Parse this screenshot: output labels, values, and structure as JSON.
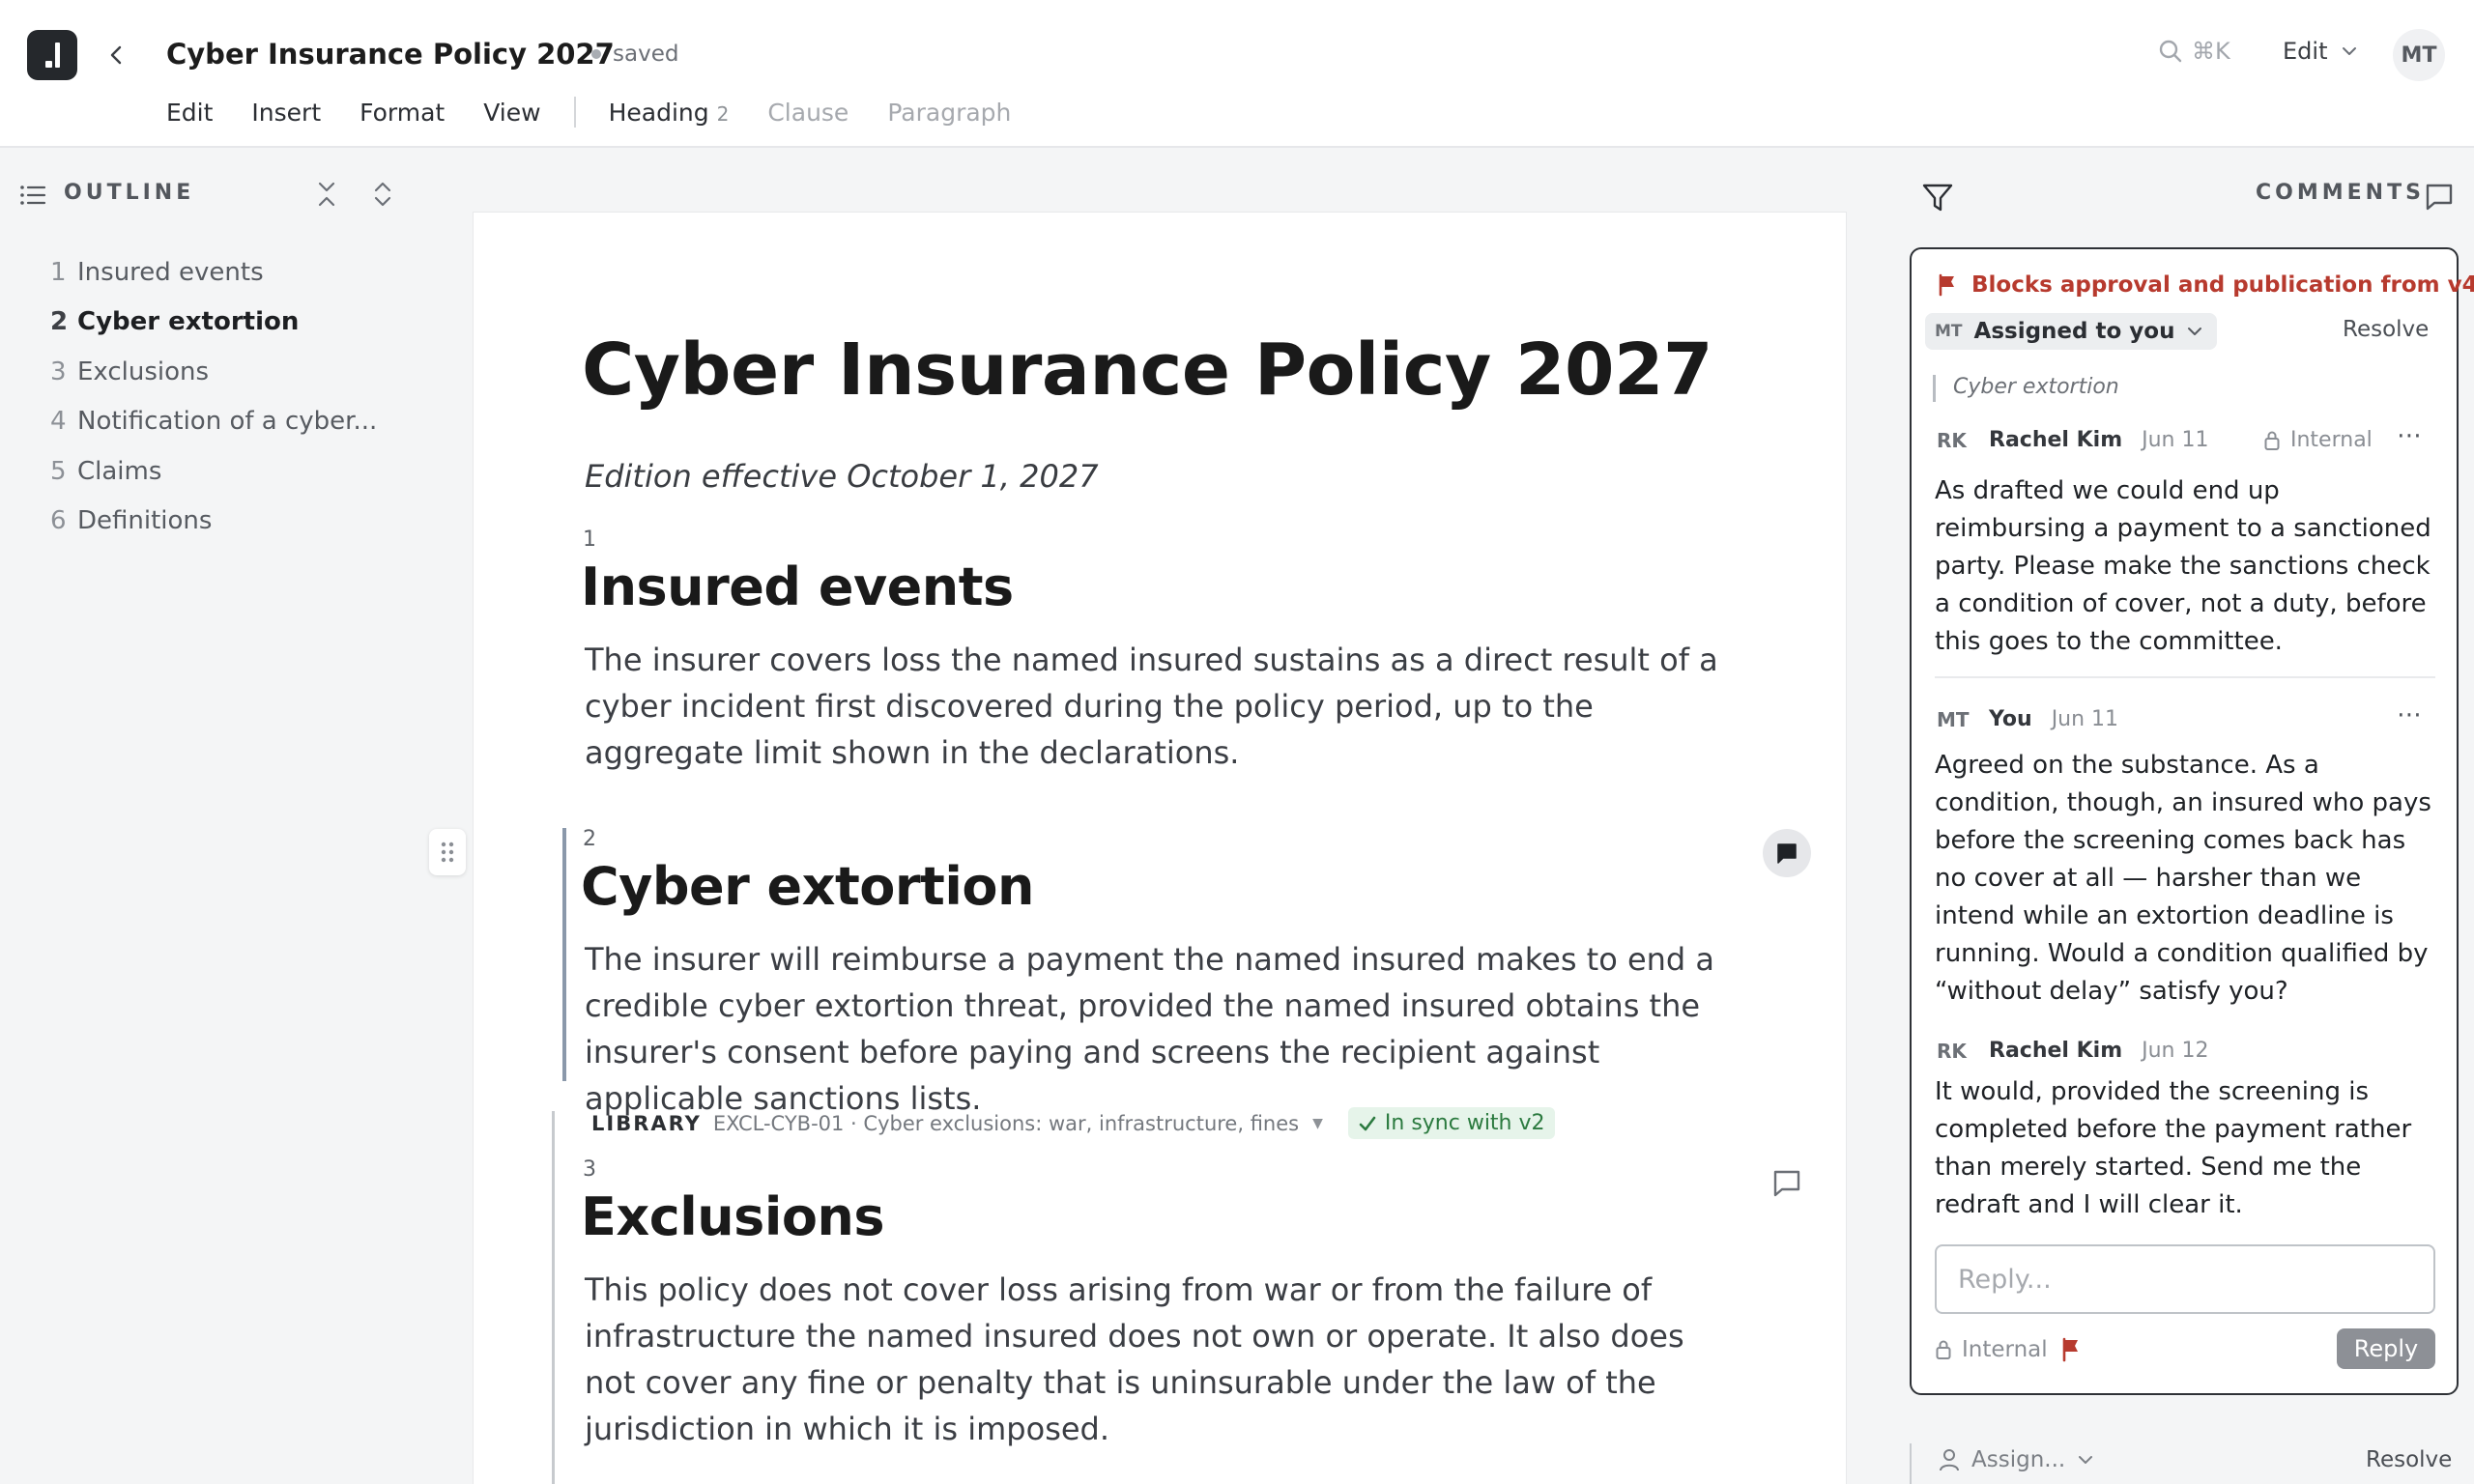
{
  "window": {
    "title": "Cyber Insurance Policy 2027",
    "save_status": "saved",
    "search_shortcut": "⌘K",
    "mode_label": "Edit",
    "user_initials": "MT"
  },
  "menu": {
    "items": [
      "Edit",
      "Insert",
      "Format",
      "View"
    ],
    "block_styles": [
      {
        "label": "Heading",
        "level": "2",
        "active": true
      },
      {
        "label": "Clause",
        "active": false
      },
      {
        "label": "Paragraph",
        "active": false
      }
    ]
  },
  "outline": {
    "title": "OUTLINE",
    "items": [
      {
        "num": "1",
        "label": "Insured events"
      },
      {
        "num": "2",
        "label": "Cyber extortion",
        "active": true
      },
      {
        "num": "3",
        "label": "Exclusions"
      },
      {
        "num": "4",
        "label": "Notification of a cyber..."
      },
      {
        "num": "5",
        "label": "Claims"
      },
      {
        "num": "6",
        "label": "Definitions"
      }
    ]
  },
  "document": {
    "title": "Cyber Insurance Policy 2027",
    "subtitle": "Edition effective October 1, 2027",
    "sections": [
      {
        "num": "1",
        "title": "Insured events",
        "body": "The insurer covers loss the named insured sustains as a direct result of a cyber incident first discovered during the policy period, up to the aggregate limit shown in the declarations."
      },
      {
        "num": "2",
        "title": "Cyber extortion",
        "body": "The insurer will reimburse a payment the named insured makes to end a credible cyber extortion threat, provided the named insured obtains the insurer's consent before paying and screens the recipient against applicable sanctions lists."
      },
      {
        "num": "3",
        "title": "Exclusions",
        "body": "This policy does not cover loss arising from war or from the failure of infrastructure the named insured does not own or operate. It also does not cover any fine or penalty that is uninsurable under the law of the jurisdiction in which it is imposed."
      }
    ],
    "library": {
      "label": "LIBRARY",
      "reference": "EXCL-CYB-01 · Cyber exclusions: war, infrastructure, fines",
      "sync_status": "In sync with v2"
    }
  },
  "comments": {
    "title": "COMMENTS",
    "thread": {
      "blocker": "Blocks approval and publication from v4",
      "assignee_initials": "MT",
      "assigned_label": "Assigned to you",
      "resolve_label": "Resolve",
      "quote": "Cyber extortion",
      "messages": [
        {
          "initials": "RK",
          "author": "Rachel Kim",
          "date": "Jun 11",
          "visibility": "Internal",
          "body": "As drafted we could end up reimbursing a payment to a sanctioned party. Please make the sanctions check a condition of cover, not a duty, before this goes to the committee."
        },
        {
          "initials": "MT",
          "author": "You",
          "date": "Jun 11",
          "body": "Agreed on the substance. As a condition, though, an insured who pays before the screening comes back has no cover at all — harsher than we intend while an extortion deadline is running. Would a condition qualified by “without delay” satisfy you?"
        },
        {
          "initials": "RK",
          "author": "Rachel Kim",
          "date": "Jun 12",
          "body": "It would, provided the screening is completed before the payment rather than merely started. Send me the redraft and I will clear it."
        }
      ],
      "reply_placeholder": "Reply...",
      "reply_visibility": "Internal",
      "reply_button": "Reply"
    },
    "next_thread": {
      "assign_label": "Assign...",
      "resolve_label": "Resolve"
    }
  },
  "colors": {
    "accent_red": "#b73a2e",
    "sync_green": "#2b7a3f",
    "selection_bar": "#8a98aa"
  }
}
